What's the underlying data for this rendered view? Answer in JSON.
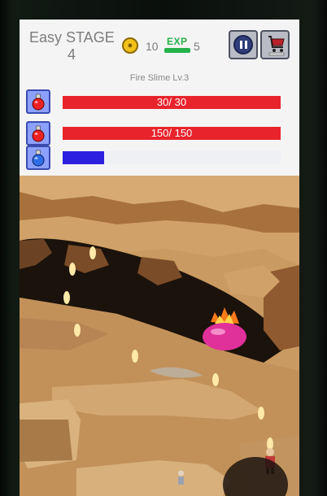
{
  "hud": {
    "difficulty_stage": "Easy STAGE",
    "stage_number": "4",
    "coins": "10",
    "exp_label": "EXP",
    "exp_value": "5"
  },
  "enemy": {
    "name": "Fire Slime Lv.3"
  },
  "bars": {
    "enemy_hp_text": "30/ 30",
    "enemy_hp_fraction": 1.0,
    "player_hp_text": "150/ 150",
    "player_hp_fraction": 1.0,
    "mana_fraction": 0.19
  },
  "colors": {
    "hp_bar": "#e8232c",
    "mana_bar": "#2d1fe0",
    "coin": "#f2c21b",
    "exp": "#25b24a",
    "pause_button": "#2f3d7a",
    "enemy_slime": "#e0309a"
  },
  "icons": {
    "pause": "pause-icon",
    "shop": "shopping-cart-icon",
    "coin": "coin-icon",
    "exp": "exp-icon",
    "red_potion": "red-potion-icon",
    "blue_potion": "blue-potion-icon"
  }
}
